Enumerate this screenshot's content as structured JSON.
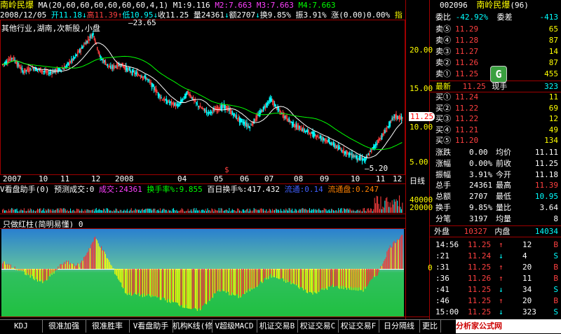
{
  "header": {
    "stock_name": "南岭民爆",
    "ma_params": "MA(20,60,60,60,60,60,60,4,1)",
    "m1": "M1:9.116",
    "m2": "M2:7.663",
    "m3": "M3:7.663",
    "m4": "M4:7.663",
    "date": "2008/12/05",
    "open": "开11.18",
    "high": "高11.39",
    "low": "低10.95",
    "close": "收11.25",
    "volume": "量24361",
    "amount": "额2707",
    "turnover": "换9.85%",
    "amplitude": "振3.91%",
    "change": "涨(0.00)0.00%",
    "indicator_label": "指",
    "sector": "其他行业,湖南,次新股,小盘"
  },
  "main_chart": {
    "y_ticks": [
      "20.00",
      "15.00",
      "10.00",
      "5.00"
    ],
    "high_label": "23.65",
    "low_label": "5.20",
    "price_tag": "11.25",
    "x_labels": [
      "2007",
      "10",
      "11",
      "12",
      "2008",
      "04",
      "05",
      "06",
      "07",
      "08",
      "09",
      "10",
      "11",
      "12"
    ],
    "marker": "$",
    "period": "日线"
  },
  "volume_panel": {
    "title": "V看盘助手(0)",
    "forecast": "预测成交:0",
    "chengjiao": "成交:24361",
    "huanshou": "换手率%:9.855",
    "bairi": "百日换手%:417.432",
    "liutong_short": "流通:0.14",
    "liutongpan": "流通盘:0.247",
    "y_ticks": [
      "40000",
      "20000"
    ]
  },
  "indicator_panel": {
    "title": "只做红柱(简明易懂) 0",
    "zero_label": "0"
  },
  "right_panel": {
    "code": "002096",
    "name": "南岭民爆",
    "suffix": "(96)",
    "weibi_label": "委比",
    "weibi_value": "-42.92%",
    "weicha_label": "委差",
    "weicha_value": "-413",
    "asks": [
      {
        "label": "卖⑤",
        "price": "11.29",
        "vol": "65"
      },
      {
        "label": "卖④",
        "price": "11.28",
        "vol": "87"
      },
      {
        "label": "卖③",
        "price": "11.27",
        "vol": "14"
      },
      {
        "label": "卖②",
        "price": "11.26",
        "vol": "87"
      },
      {
        "label": "卖①",
        "price": "11.25",
        "vol": "455"
      }
    ],
    "latest_label": "最新",
    "latest_price": "11.25",
    "xianshou_label": "现手",
    "xianshou_value": "323",
    "bids": [
      {
        "label": "买①",
        "price": "11.24",
        "vol": "11"
      },
      {
        "label": "买②",
        "price": "11.22",
        "vol": "69"
      },
      {
        "label": "买③",
        "price": "11.22",
        "vol": "12"
      },
      {
        "label": "买④",
        "price": "11.21",
        "vol": "49"
      },
      {
        "label": "买⑤",
        "price": "11.20",
        "vol": "134"
      }
    ],
    "stats": [
      {
        "l1": "涨跌",
        "v1": "0.00",
        "l2": "均价",
        "v2": "11.11"
      },
      {
        "l1": "涨幅",
        "v1": "0.00%",
        "l2": "前收",
        "v2": "11.25"
      },
      {
        "l1": "振幅",
        "v1": "3.91%",
        "l2": "今开",
        "v2": "11.18"
      },
      {
        "l1": "总手",
        "v1": "24361",
        "l2": "最高",
        "v2": "11.39"
      },
      {
        "l1": "总额",
        "v1": "2707",
        "l2": "最低",
        "v2": "10.95"
      },
      {
        "l1": "换手",
        "v1": "9.85%",
        "l2": "量比",
        "v2": "3.64"
      },
      {
        "l1": "分笔",
        "v1": "3197",
        "l2": "均量",
        "v2": "8"
      }
    ],
    "waipan_label": "外盘",
    "waipan_value": "10327",
    "neipan_label": "内盘",
    "neipan_value": "14034",
    "ticks": [
      {
        "time": "14:56",
        "price": "11.25",
        "arrow": "↑",
        "vol": "12",
        "side": "B"
      },
      {
        "time": ":21",
        "price": "11.24",
        "arrow": "↓",
        "vol": "4",
        "side": "S"
      },
      {
        "time": ":31",
        "price": "11.25",
        "arrow": "↑",
        "vol": "20",
        "side": "B"
      },
      {
        "time": ":36",
        "price": "11.26",
        "arrow": "↑",
        "vol": "11",
        "side": "B"
      },
      {
        "time": ":41",
        "price": "11.25",
        "arrow": "↓",
        "vol": "34",
        "side": "S"
      },
      {
        "time": ":46",
        "price": "11.25",
        "arrow": "↑",
        "vol": "20",
        "side": "B"
      },
      {
        "time": "15:00",
        "price": "11.25",
        "arrow": "↓",
        "vol": "323",
        "side": "S"
      }
    ],
    "logo": "G"
  },
  "bottom_tabs": [
    "KDJ",
    "很准加强",
    "很准胜率",
    "V看盘助手",
    "机构K线(修",
    "V超级MACD",
    "机证交易B",
    "权证交易C",
    "权证交易F",
    "日分隔线",
    "更比"
  ],
  "watermark": {
    "site_name": "分析家公式网",
    "site_url": "www.88gg.com"
  },
  "colors": {
    "up": "#ff4040",
    "down": "#00ffff",
    "ma_white": "#ffffff",
    "ma_green": "#00ff00",
    "grid_border": "#a00000"
  }
}
